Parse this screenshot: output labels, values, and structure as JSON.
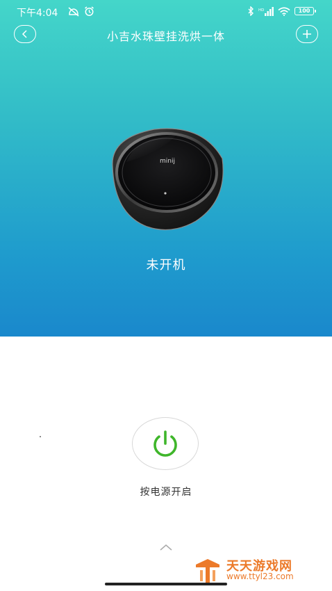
{
  "status_bar": {
    "time": "下午4:04",
    "battery": "100"
  },
  "header": {
    "title": "小吉水珠壁挂洗烘一体",
    "back_icon": "chevron-left-icon",
    "add_icon": "plus-icon"
  },
  "device": {
    "brand_text": "minij",
    "status": "未开机"
  },
  "power": {
    "icon": "power-icon",
    "icon_color": "#3fb62b",
    "label": "按电源开启"
  },
  "watermark": {
    "name": "天天游戏网",
    "url": "www.ttyl23.com"
  },
  "colors": {
    "hero_top": "#44d6c9",
    "hero_bottom": "#1a88cc"
  }
}
